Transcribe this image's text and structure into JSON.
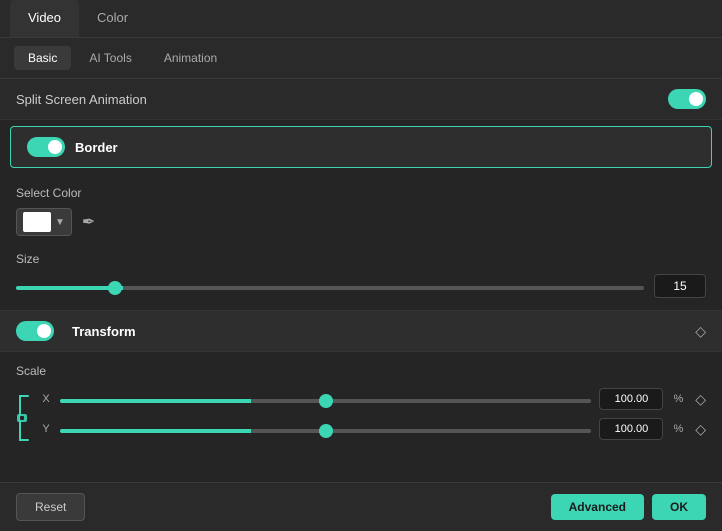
{
  "topTabs": [
    {
      "label": "Video",
      "active": true
    },
    {
      "label": "Color",
      "active": false
    }
  ],
  "subTabs": [
    {
      "label": "Basic",
      "active": true
    },
    {
      "label": "AI Tools",
      "active": false
    },
    {
      "label": "Animation",
      "active": false
    }
  ],
  "splitScreen": {
    "label": "Split Screen Animation",
    "enabled": true
  },
  "border": {
    "label": "Border",
    "enabled": true,
    "selectColorLabel": "Select Color",
    "colorValue": "#ffffff",
    "sizeLabel": "Size",
    "sizeValue": "15",
    "sliderValue": 15
  },
  "transform": {
    "label": "Transform",
    "enabled": true
  },
  "scale": {
    "label": "Scale",
    "x": {
      "label": "X",
      "value": "100.00",
      "unit": "%"
    },
    "y": {
      "label": "Y",
      "value": "100.00",
      "unit": "%"
    }
  },
  "footer": {
    "resetLabel": "Reset",
    "advancedLabel": "Advanced",
    "okLabel": "OK"
  }
}
